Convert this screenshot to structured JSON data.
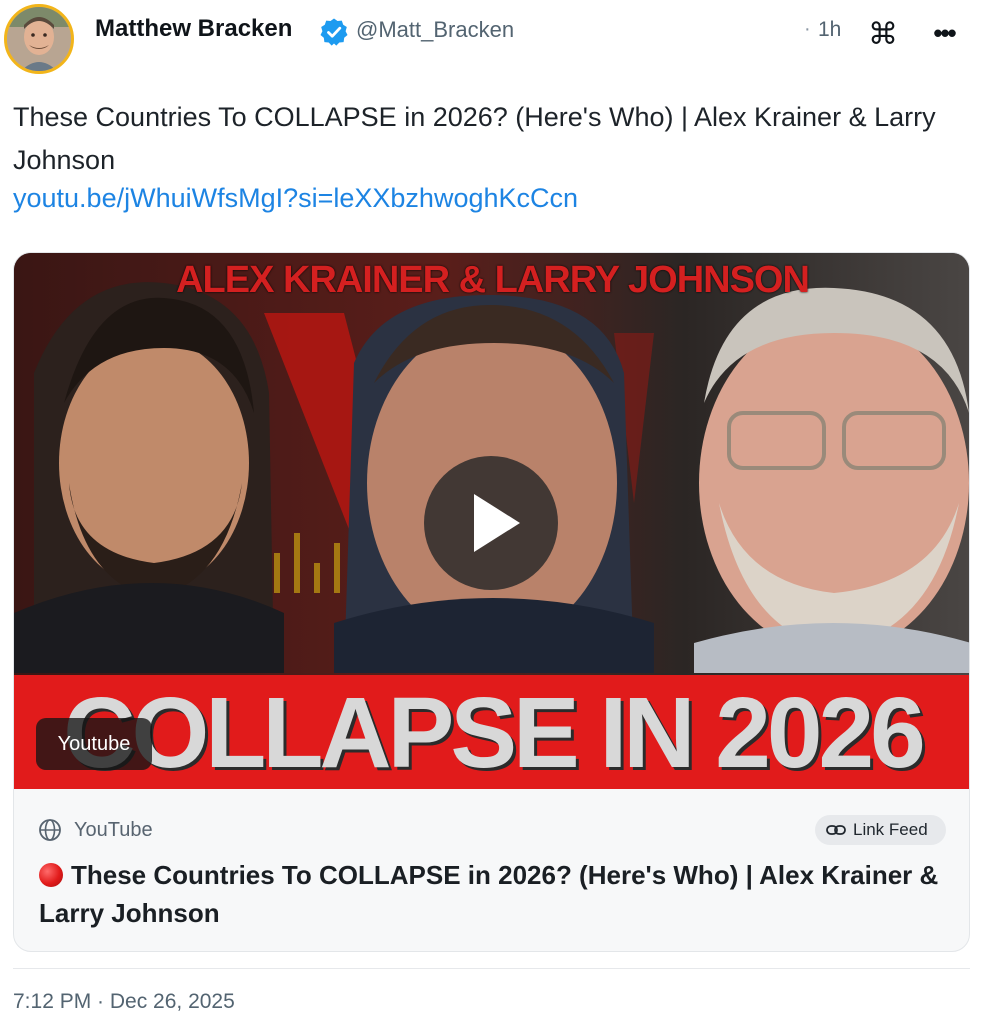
{
  "author": {
    "name": "Matthew Bracken",
    "handle": "@Matt_Bracken",
    "verified": true,
    "avatar_icon": "profile-photo"
  },
  "meta": {
    "time_separator": "·",
    "time_ago": "1h",
    "command_icon": "⌘",
    "more_icon": "•••"
  },
  "post": {
    "text": "These Countries To COLLAPSE in 2026? (Here's Who) | Alex Krainer & Larry Johnson",
    "link": "youtu.be/jWhuiWfsMgI?si=leXXbzhwoghKcCcn"
  },
  "card": {
    "thumbnail_top_text": "ALEX KRAINER & LARRY JOHNSON",
    "thumbnail_bottom_text": "COLLAPSE IN 2026",
    "badge": "Youtube",
    "source": "YouTube",
    "link_feed_label": "Link Feed",
    "title": "These Countries To COLLAPSE in 2026? (Here's Who) | Alex Krainer & Larry Johnson"
  },
  "footer": {
    "timestamp": "7:12 PM · Dec 26, 2025"
  },
  "colors": {
    "link": "#1d84e3",
    "verified_badge": "#1d9bf0",
    "avatar_ring": "#f2b51a",
    "thumbnail_red": "#e11b1b"
  }
}
